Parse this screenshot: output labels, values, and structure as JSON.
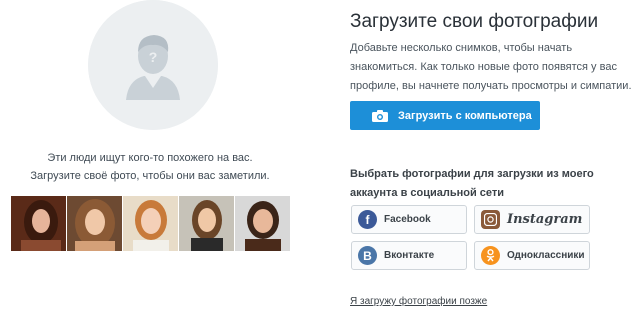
{
  "left": {
    "hint_line1": "Эти люди ищут кого-то похожего на вас.",
    "hint_line2": "Загрузите своё фото, чтобы они вас заметили.",
    "photos": [
      "user-photo-1",
      "user-photo-2",
      "user-photo-3",
      "user-photo-4",
      "user-photo-5"
    ]
  },
  "right": {
    "title": "Загрузите свои фотографии",
    "description": "Добавьте несколько снимков, чтобы начать знакомиться. Как только новые фото появятся у вас профиле, вы начнете получать просмотры и симпатии.",
    "upload_button": "Загрузить с компьютера",
    "social_title": "Выбрать фотографии для загрузки из моего аккаунта в социальной сети",
    "social": {
      "facebook": "Facebook",
      "instagram": "Instagram",
      "vkontakte": "Вконтакте",
      "odnoklassniki": "Одноклассники"
    },
    "later_link": "Я загружу фотографии позже"
  },
  "colors": {
    "accent": "#1d8fd8",
    "facebook": "#3b5998",
    "vkontakte": "#4a76a8",
    "odnoklassniki": "#f7931e"
  }
}
